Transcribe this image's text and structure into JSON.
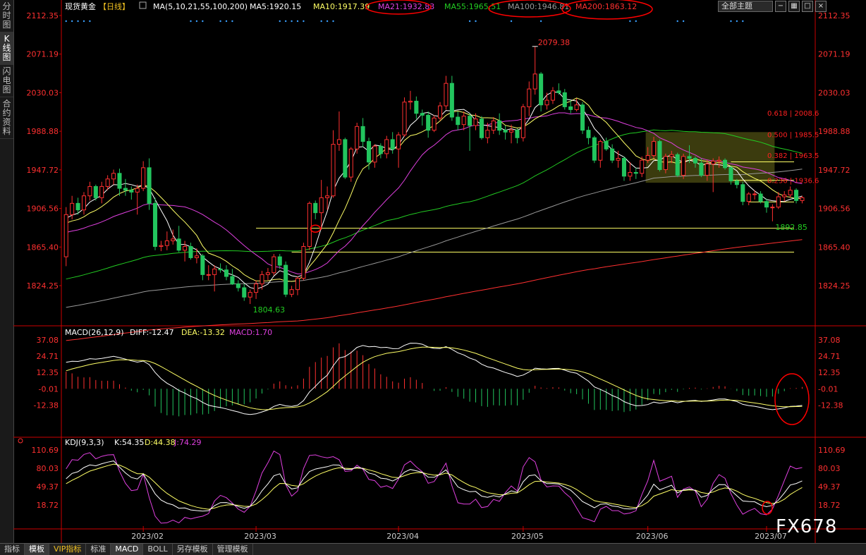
{
  "left_tabs": [
    "分时图",
    "K线图",
    "闪电图",
    "合约资料"
  ],
  "bottom_tabs": [
    "指标",
    "模板",
    "VIP指标",
    "标准",
    "MACD",
    "BOLL",
    "另存模板",
    "管理模板"
  ],
  "header": {
    "instrument": "现货黄金",
    "period": "【日线】",
    "ma_label": "MA(5,10,21,55,100,200)",
    "ma5": "MA5:1920.15",
    "ma10": "MA10:1917.39",
    "ma21": "MA21:1932.83",
    "ma55": "MA55:1965.51",
    "ma100": "MA100:1946.81",
    "ma200": "MA200:1863.12",
    "theme_select": "全部主题"
  },
  "period_label": "日线",
  "watermark": "FX678",
  "colors": {
    "up": "#ff3030",
    "down": "#22c55e",
    "ma5": "#ffffff",
    "ma10": "#ffff66",
    "ma21": "#e040e0",
    "ma55": "#22cc22",
    "ma100": "#999999",
    "ma200": "#ff3030",
    "axis": "#cc0000",
    "fib": "#ff2020",
    "hline": "#ffff66"
  },
  "chart_data": {
    "main": {
      "type": "candlestick",
      "y_ticks": [
        "2112.35",
        "2071.19",
        "2030.03",
        "1988.88",
        "1947.72",
        "1906.56",
        "1865.40",
        "1824.25"
      ],
      "ylim": [
        1794,
        2112.35
      ],
      "x_labels": [
        "2023/02",
        "2023/03",
        "2023/04",
        "2023/05",
        "2023/06",
        "2023/07"
      ],
      "annotations": {
        "high": "2079.38",
        "low_march": "1804.63",
        "low_june": "1892.85"
      },
      "fib_levels": [
        {
          "label": "0.618 | 2008.6",
          "value": 2008.6
        },
        {
          "label": "0.500 | 1985.5",
          "value": 1985.5
        },
        {
          "label": "0.382 | 1963.5",
          "value": 1963.5
        },
        {
          "label": "0.236 | 1936.6",
          "value": 1936.6
        }
      ],
      "hlines": [
        1956.3,
        1936.6,
        1913.5,
        1885.5,
        1860.0
      ],
      "candles": [
        {
          "d": "01/13",
          "o": 1855,
          "h": 1908,
          "l": 1845,
          "c": 1900
        },
        {
          "d": "01/16",
          "o": 1900,
          "h": 1920,
          "l": 1895,
          "c": 1912
        },
        {
          "d": "01/17",
          "o": 1912,
          "h": 1918,
          "l": 1900,
          "c": 1905
        },
        {
          "d": "01/18",
          "o": 1905,
          "h": 1924,
          "l": 1900,
          "c": 1920
        },
        {
          "d": "01/19",
          "o": 1920,
          "h": 1935,
          "l": 1915,
          "c": 1930
        },
        {
          "d": "01/20",
          "o": 1930,
          "h": 1932,
          "l": 1915,
          "c": 1918
        },
        {
          "d": "01/23",
          "o": 1918,
          "h": 1935,
          "l": 1912,
          "c": 1930
        },
        {
          "d": "01/24",
          "o": 1930,
          "h": 1942,
          "l": 1926,
          "c": 1938
        },
        {
          "d": "01/25",
          "o": 1938,
          "h": 1948,
          "l": 1932,
          "c": 1944
        },
        {
          "d": "01/26",
          "o": 1944,
          "h": 1949,
          "l": 1920,
          "c": 1928
        },
        {
          "d": "01/27",
          "o": 1928,
          "h": 1938,
          "l": 1920,
          "c": 1926
        },
        {
          "d": "01/30",
          "o": 1926,
          "h": 1930,
          "l": 1916,
          "c": 1924
        },
        {
          "d": "01/31",
          "o": 1924,
          "h": 1932,
          "l": 1900,
          "c": 1928
        },
        {
          "d": "02/01",
          "o": 1928,
          "h": 1957,
          "l": 1925,
          "c": 1950
        },
        {
          "d": "02/02",
          "o": 1950,
          "h": 1960,
          "l": 1905,
          "c": 1912
        },
        {
          "d": "02/03",
          "o": 1912,
          "h": 1918,
          "l": 1862,
          "c": 1866
        },
        {
          "d": "02/06",
          "o": 1866,
          "h": 1872,
          "l": 1861,
          "c": 1867
        },
        {
          "d": "02/07",
          "o": 1867,
          "h": 1882,
          "l": 1862,
          "c": 1872
        },
        {
          "d": "02/08",
          "o": 1872,
          "h": 1884,
          "l": 1868,
          "c": 1874
        },
        {
          "d": "02/09",
          "o": 1874,
          "h": 1888,
          "l": 1860,
          "c": 1862
        },
        {
          "d": "02/10",
          "o": 1862,
          "h": 1872,
          "l": 1850,
          "c": 1866
        },
        {
          "d": "02/13",
          "o": 1866,
          "h": 1870,
          "l": 1852,
          "c": 1854
        },
        {
          "d": "02/14",
          "o": 1854,
          "h": 1864,
          "l": 1848,
          "c": 1856
        },
        {
          "d": "02/15",
          "o": 1856,
          "h": 1858,
          "l": 1830,
          "c": 1836
        },
        {
          "d": "02/16",
          "o": 1836,
          "h": 1846,
          "l": 1830,
          "c": 1836
        },
        {
          "d": "02/17",
          "o": 1836,
          "h": 1846,
          "l": 1818,
          "c": 1842
        },
        {
          "d": "02/20",
          "o": 1842,
          "h": 1848,
          "l": 1838,
          "c": 1841
        },
        {
          "d": "02/21",
          "o": 1841,
          "h": 1846,
          "l": 1830,
          "c": 1834
        },
        {
          "d": "02/22",
          "o": 1834,
          "h": 1842,
          "l": 1825,
          "c": 1826
        },
        {
          "d": "02/23",
          "o": 1826,
          "h": 1830,
          "l": 1818,
          "c": 1822
        },
        {
          "d": "02/24",
          "o": 1822,
          "h": 1826,
          "l": 1808,
          "c": 1812
        },
        {
          "d": "02/27",
          "o": 1812,
          "h": 1820,
          "l": 1804.63,
          "c": 1817
        },
        {
          "d": "02/28",
          "o": 1817,
          "h": 1830,
          "l": 1810,
          "c": 1826
        },
        {
          "d": "03/01",
          "o": 1826,
          "h": 1840,
          "l": 1820,
          "c": 1836
        },
        {
          "d": "03/02",
          "o": 1836,
          "h": 1843,
          "l": 1830,
          "c": 1838
        },
        {
          "d": "03/03",
          "o": 1838,
          "h": 1858,
          "l": 1835,
          "c": 1855
        },
        {
          "d": "03/06",
          "o": 1855,
          "h": 1858,
          "l": 1842,
          "c": 1846
        },
        {
          "d": "03/07",
          "o": 1846,
          "h": 1850,
          "l": 1812,
          "c": 1815
        },
        {
          "d": "03/08",
          "o": 1815,
          "h": 1824,
          "l": 1812,
          "c": 1820
        },
        {
          "d": "03/09",
          "o": 1820,
          "h": 1834,
          "l": 1814,
          "c": 1832
        },
        {
          "d": "03/10",
          "o": 1832,
          "h": 1870,
          "l": 1830,
          "c": 1866
        },
        {
          "d": "03/13",
          "o": 1866,
          "h": 1914,
          "l": 1862,
          "c": 1912
        },
        {
          "d": "03/14",
          "o": 1912,
          "h": 1915,
          "l": 1895,
          "c": 1902
        },
        {
          "d": "03/15",
          "o": 1902,
          "h": 1937,
          "l": 1884,
          "c": 1918
        },
        {
          "d": "03/16",
          "o": 1918,
          "h": 1930,
          "l": 1905,
          "c": 1920
        },
        {
          "d": "03/17",
          "o": 1920,
          "h": 1990,
          "l": 1918,
          "c": 1975
        },
        {
          "d": "03/20",
          "o": 1975,
          "h": 2010,
          "l": 1968,
          "c": 1980
        },
        {
          "d": "03/21",
          "o": 1980,
          "h": 1982,
          "l": 1938,
          "c": 1940
        },
        {
          "d": "03/22",
          "o": 1940,
          "h": 1972,
          "l": 1935,
          "c": 1970
        },
        {
          "d": "03/23",
          "o": 1970,
          "h": 1998,
          "l": 1965,
          "c": 1994
        },
        {
          "d": "03/24",
          "o": 1994,
          "h": 2003,
          "l": 1972,
          "c": 1978
        },
        {
          "d": "03/27",
          "o": 1978,
          "h": 1982,
          "l": 1948,
          "c": 1956
        },
        {
          "d": "03/28",
          "o": 1956,
          "h": 1975,
          "l": 1950,
          "c": 1973
        },
        {
          "d": "03/29",
          "o": 1973,
          "h": 1976,
          "l": 1960,
          "c": 1965
        },
        {
          "d": "03/30",
          "o": 1965,
          "h": 1984,
          "l": 1960,
          "c": 1980
        },
        {
          "d": "03/31",
          "o": 1980,
          "h": 1988,
          "l": 1965,
          "c": 1970
        },
        {
          "d": "04/03",
          "o": 1970,
          "h": 1988,
          "l": 1950,
          "c": 1985
        },
        {
          "d": "04/04",
          "o": 1985,
          "h": 2025,
          "l": 1983,
          "c": 2020
        },
        {
          "d": "04/05",
          "o": 2020,
          "h": 2032,
          "l": 2012,
          "c": 2021
        },
        {
          "d": "04/06",
          "o": 2021,
          "h": 2026,
          "l": 2002,
          "c": 2008
        },
        {
          "d": "04/07",
          "o": 2008,
          "h": 2012,
          "l": 1995,
          "c": 2006
        },
        {
          "d": "04/10",
          "o": 2006,
          "h": 2010,
          "l": 1982,
          "c": 1990
        },
        {
          "d": "04/11",
          "o": 1990,
          "h": 2006,
          "l": 1988,
          "c": 2003
        },
        {
          "d": "04/12",
          "o": 2003,
          "h": 2020,
          "l": 2000,
          "c": 2016
        },
        {
          "d": "04/13",
          "o": 2016,
          "h": 2048,
          "l": 2012,
          "c": 2040
        },
        {
          "d": "04/14",
          "o": 2040,
          "h": 2048,
          "l": 2000,
          "c": 2004
        },
        {
          "d": "04/17",
          "o": 2004,
          "h": 2010,
          "l": 1990,
          "c": 1996
        },
        {
          "d": "04/18",
          "o": 1996,
          "h": 2010,
          "l": 1990,
          "c": 2005
        },
        {
          "d": "04/19",
          "o": 2005,
          "h": 2008,
          "l": 1968,
          "c": 1995
        },
        {
          "d": "04/20",
          "o": 1995,
          "h": 2008,
          "l": 1990,
          "c": 2002
        },
        {
          "d": "04/21",
          "o": 2002,
          "h": 2005,
          "l": 1980,
          "c": 1982
        },
        {
          "d": "04/24",
          "o": 1982,
          "h": 1998,
          "l": 1976,
          "c": 1990
        },
        {
          "d": "04/25",
          "o": 1990,
          "h": 2004,
          "l": 1986,
          "c": 2000
        },
        {
          "d": "04/26",
          "o": 2000,
          "h": 2008,
          "l": 1985,
          "c": 1990
        },
        {
          "d": "04/27",
          "o": 1990,
          "h": 1995,
          "l": 1980,
          "c": 1988
        },
        {
          "d": "04/28",
          "o": 1988,
          "h": 1996,
          "l": 1976,
          "c": 1990
        },
        {
          "d": "05/01",
          "o": 1990,
          "h": 1992,
          "l": 1976,
          "c": 1982
        },
        {
          "d": "05/02",
          "o": 1982,
          "h": 2018,
          "l": 1978,
          "c": 2015
        },
        {
          "d": "05/03",
          "o": 2015,
          "h": 2042,
          "l": 2005,
          "c": 2034
        },
        {
          "d": "05/04",
          "o": 2034,
          "h": 2079.38,
          "l": 2028,
          "c": 2050
        },
        {
          "d": "05/05",
          "o": 2050,
          "h": 2052,
          "l": 2010,
          "c": 2017
        },
        {
          "d": "05/08",
          "o": 2017,
          "h": 2030,
          "l": 2012,
          "c": 2022
        },
        {
          "d": "05/09",
          "o": 2022,
          "h": 2036,
          "l": 2018,
          "c": 2032
        },
        {
          "d": "05/10",
          "o": 2032,
          "h": 2040,
          "l": 2028,
          "c": 2030
        },
        {
          "d": "05/11",
          "o": 2030,
          "h": 2034,
          "l": 2012,
          "c": 2015
        },
        {
          "d": "05/12",
          "o": 2015,
          "h": 2022,
          "l": 2008,
          "c": 2012
        },
        {
          "d": "05/15",
          "o": 2012,
          "h": 2024,
          "l": 2010,
          "c": 2017
        },
        {
          "d": "05/16",
          "o": 2017,
          "h": 2020,
          "l": 1986,
          "c": 1990
        },
        {
          "d": "05/17",
          "o": 1990,
          "h": 1994,
          "l": 1975,
          "c": 1982
        },
        {
          "d": "05/18",
          "o": 1982,
          "h": 1984,
          "l": 1955,
          "c": 1958
        },
        {
          "d": "05/19",
          "o": 1958,
          "h": 1980,
          "l": 1950,
          "c": 1978
        },
        {
          "d": "05/22",
          "o": 1978,
          "h": 1982,
          "l": 1968,
          "c": 1970
        },
        {
          "d": "05/23",
          "o": 1970,
          "h": 1975,
          "l": 1955,
          "c": 1958
        },
        {
          "d": "05/24",
          "o": 1958,
          "h": 1968,
          "l": 1950,
          "c": 1960
        },
        {
          "d": "05/25",
          "o": 1960,
          "h": 1962,
          "l": 1936,
          "c": 1941
        },
        {
          "d": "05/26",
          "o": 1941,
          "h": 1956,
          "l": 1936,
          "c": 1945
        },
        {
          "d": "05/29",
          "o": 1945,
          "h": 1950,
          "l": 1938,
          "c": 1944
        },
        {
          "d": "05/30",
          "o": 1944,
          "h": 1962,
          "l": 1940,
          "c": 1958
        },
        {
          "d": "05/31",
          "o": 1958,
          "h": 1972,
          "l": 1955,
          "c": 1963
        },
        {
          "d": "06/01",
          "o": 1963,
          "h": 1983,
          "l": 1960,
          "c": 1978
        },
        {
          "d": "06/02",
          "o": 1978,
          "h": 1980,
          "l": 1946,
          "c": 1948
        },
        {
          "d": "06/05",
          "o": 1948,
          "h": 1965,
          "l": 1944,
          "c": 1962
        },
        {
          "d": "06/06",
          "o": 1962,
          "h": 1968,
          "l": 1955,
          "c": 1964
        },
        {
          "d": "06/07",
          "o": 1964,
          "h": 1966,
          "l": 1940,
          "c": 1942
        },
        {
          "d": "06/08",
          "o": 1942,
          "h": 1965,
          "l": 1938,
          "c": 1962
        },
        {
          "d": "06/09",
          "o": 1962,
          "h": 1974,
          "l": 1955,
          "c": 1960
        },
        {
          "d": "06/12",
          "o": 1960,
          "h": 1962,
          "l": 1950,
          "c": 1955
        },
        {
          "d": "06/13",
          "o": 1955,
          "h": 1960,
          "l": 1940,
          "c": 1942
        },
        {
          "d": "06/14",
          "o": 1942,
          "h": 1958,
          "l": 1936,
          "c": 1954
        },
        {
          "d": "06/15",
          "o": 1954,
          "h": 1960,
          "l": 1924,
          "c": 1957
        },
        {
          "d": "06/16",
          "o": 1957,
          "h": 1962,
          "l": 1950,
          "c": 1958
        },
        {
          "d": "06/19",
          "o": 1958,
          "h": 1960,
          "l": 1948,
          "c": 1950
        },
        {
          "d": "06/20",
          "o": 1950,
          "h": 1952,
          "l": 1932,
          "c": 1936
        },
        {
          "d": "06/21",
          "o": 1936,
          "h": 1938,
          "l": 1928,
          "c": 1932
        },
        {
          "d": "06/22",
          "o": 1932,
          "h": 1935,
          "l": 1910,
          "c": 1914
        },
        {
          "d": "06/23",
          "o": 1914,
          "h": 1924,
          "l": 1910,
          "c": 1922
        },
        {
          "d": "06/26",
          "o": 1922,
          "h": 1926,
          "l": 1916,
          "c": 1922
        },
        {
          "d": "06/27",
          "o": 1922,
          "h": 1925,
          "l": 1912,
          "c": 1914
        },
        {
          "d": "06/28",
          "o": 1914,
          "h": 1917,
          "l": 1902,
          "c": 1908
        },
        {
          "d": "06/29",
          "o": 1908,
          "h": 1911,
          "l": 1892.85,
          "c": 1908
        },
        {
          "d": "06/30",
          "o": 1908,
          "h": 1924,
          "l": 1906,
          "c": 1919
        },
        {
          "d": "07/03",
          "o": 1919,
          "h": 1925,
          "l": 1914,
          "c": 1921
        },
        {
          "d": "07/04",
          "o": 1921,
          "h": 1930,
          "l": 1918,
          "c": 1926
        },
        {
          "d": "07/05",
          "o": 1926,
          "h": 1928,
          "l": 1912,
          "c": 1915
        },
        {
          "d": "07/06",
          "o": 1915,
          "h": 1920,
          "l": 1912,
          "c": 1918
        }
      ]
    },
    "macd": {
      "label": "MACD(26,12,9)",
      "diff": "DIFF:-12.47",
      "dea": "DEA:-13.32",
      "macd": "MACD:1.70",
      "y_ticks": [
        "37.08",
        "24.71",
        "12.35",
        "-0.01",
        "-12.38"
      ],
      "ylim": [
        -25,
        37.08
      ]
    },
    "kdj": {
      "label": "KDJ(9,3,3)",
      "k": "K:54.35",
      "d": "D:44.38",
      "j": "J:74.29",
      "y_ticks": [
        "110.69",
        "80.03",
        "49.37",
        "18.72"
      ],
      "ylim": [
        -12,
        110.69
      ]
    }
  }
}
